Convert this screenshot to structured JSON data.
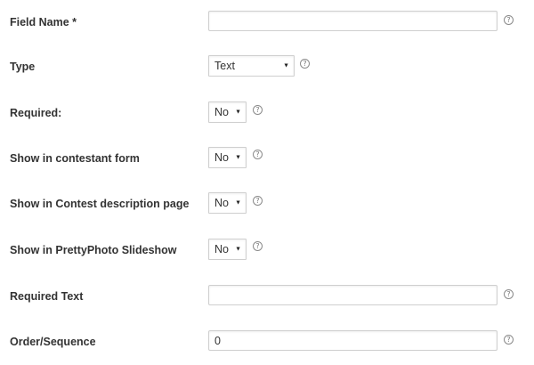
{
  "fields": [
    {
      "label": "Field Name *",
      "control": "text",
      "value": "",
      "help": "?"
    },
    {
      "label": "Type",
      "control": "select",
      "value": "Text",
      "help": "?"
    },
    {
      "label": "Required:",
      "control": "select",
      "value": "No",
      "help": "?"
    },
    {
      "label": "Show in contestant form",
      "control": "select",
      "value": "No",
      "help": "?"
    },
    {
      "label": "Show in Contest description page",
      "control": "select",
      "value": "No",
      "help": "?"
    },
    {
      "label": "Show in PrettyPhoto Slideshow",
      "control": "select",
      "value": "No",
      "help": "?"
    },
    {
      "label": "Required Text",
      "control": "text",
      "value": "",
      "help": "?"
    },
    {
      "label": "Order/Sequence",
      "control": "text",
      "value": "0",
      "help": "?"
    }
  ],
  "icons": {
    "help": "question-circle-icon",
    "dropdown": "triangle-down-icon"
  },
  "colors": {
    "label_text": "#333333",
    "input_border": "#cfcfcf",
    "help_icon": "#8a8a8a",
    "background": "#ffffff"
  }
}
